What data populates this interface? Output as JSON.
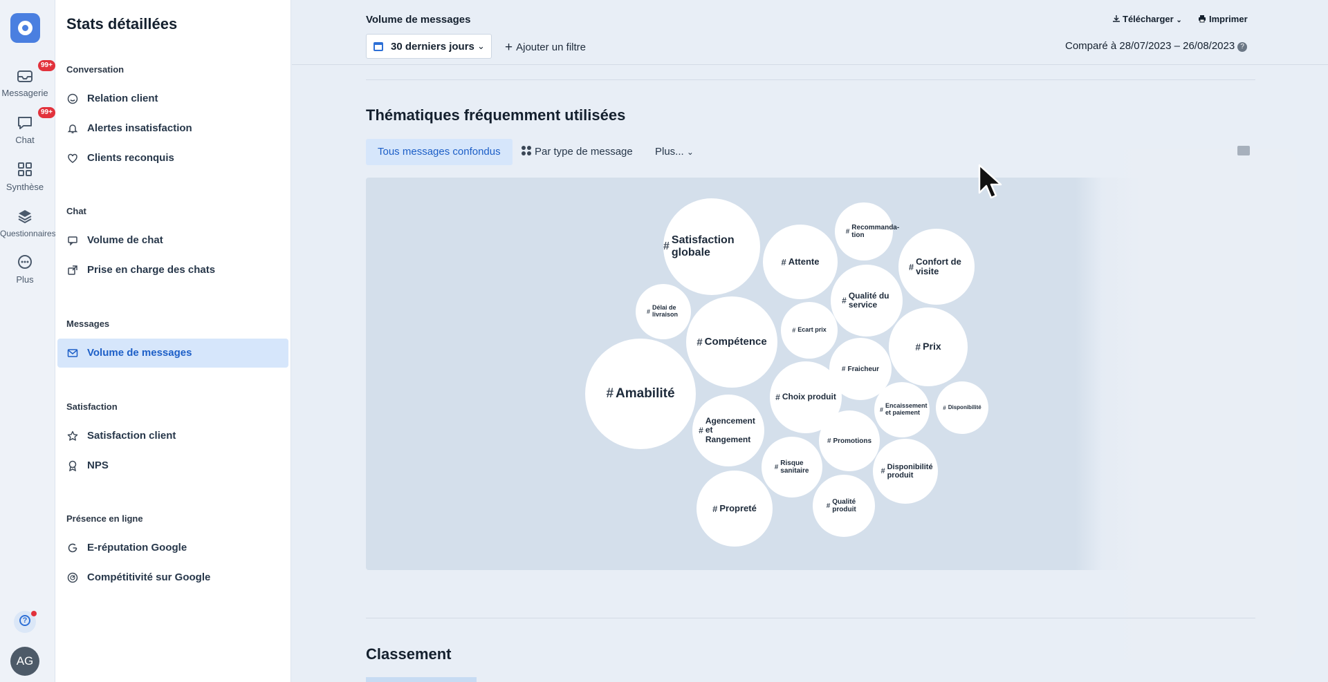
{
  "rail": {
    "items": [
      {
        "label": "Messagerie",
        "badge": "99+"
      },
      {
        "label": "Chat",
        "badge": "99+"
      },
      {
        "label": "Synthèse"
      },
      {
        "label": "Questionnaires"
      },
      {
        "label": "Plus"
      }
    ],
    "avatar": "AG",
    "help": "?"
  },
  "nav": {
    "title": "Stats détaillées",
    "sections": [
      {
        "title": "Conversation",
        "items": [
          "Relation client",
          "Alertes insatisfaction",
          "Clients reconquis"
        ]
      },
      {
        "title": "Chat",
        "items": [
          "Volume de chat",
          "Prise en charge des chats"
        ]
      },
      {
        "title": "Messages",
        "items": [
          "Volume de messages"
        ]
      },
      {
        "title": "Satisfaction",
        "items": [
          "Satisfaction client",
          "NPS"
        ]
      },
      {
        "title": "Présence en ligne",
        "items": [
          "E-réputation Google",
          "Compétitivité sur Google"
        ]
      }
    ],
    "active_item": "Volume de messages"
  },
  "header": {
    "title": "Volume de messages",
    "date_range": "30 derniers jours",
    "add_filter": "Ajouter un filtre",
    "download": "Télécharger",
    "print": "Imprimer",
    "compare": "Comparé à 28/07/2023 – 26/08/2023"
  },
  "themes": {
    "title": "Thématiques fréquemment utilisées",
    "tabs": [
      "Tous messages confondus",
      "Par type de message",
      "Plus..."
    ],
    "active_tab": "Tous messages confondus",
    "bubbles": [
      "Satisfaction globale",
      "Attente",
      "Recommanda- tion",
      "Confort de visite",
      "Délai de livraison",
      "Compétence",
      "Qualité du service",
      "Ecart prix",
      "Prix",
      "Amabilité",
      "Fraicheur",
      "Choix produit",
      "Encaissement et paiement",
      "Disponibilité",
      "Agencement et Rangement",
      "Promotions",
      "Risque sanitaire",
      "Disponibilité produit",
      "Propreté",
      "Qualité produit"
    ]
  },
  "ranking": {
    "title": "Classement"
  }
}
